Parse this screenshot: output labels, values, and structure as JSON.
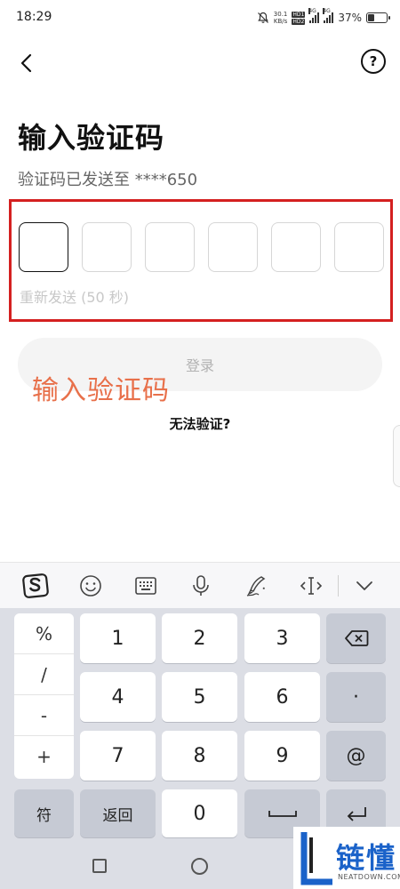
{
  "status_bar": {
    "time": "18:29",
    "net_speed_value": "30.1",
    "net_speed_unit": "KB/s",
    "hd_badge_1": "HD1",
    "hd_badge_2": "HD2",
    "network_1": "4G",
    "network_2": "4G",
    "battery_percent": "37%",
    "battery_level": 0.37
  },
  "header": {
    "back_icon": "chevron-left-icon",
    "help_icon": "question-circle-icon",
    "help_symbol": "?"
  },
  "page": {
    "title": "输入验证码",
    "subtitle": "验证码已发送至 ****650"
  },
  "code_input": {
    "box_count": 6,
    "active_index": 0,
    "resend_text": "重新发送 (50 秒)"
  },
  "login_button_label": "登录",
  "overlay_caption": "输入验证码",
  "cant_verify_link": "无法验证?",
  "keyboard_toolbar": {
    "icons": [
      "sogou-logo-icon",
      "emoji-icon",
      "keyboard-icon",
      "microphone-icon",
      "handwriting-icon",
      "cursor-move-icon",
      "chevron-down-icon"
    ]
  },
  "keyboard": {
    "symbols": [
      "%",
      "/",
      "-",
      "+"
    ],
    "digits": [
      "1",
      "2",
      "3",
      "4",
      "5",
      "6",
      "7",
      "8",
      "9",
      "0"
    ],
    "dot": "·",
    "at": "@",
    "symbol_switch": "符",
    "back_label": "返回",
    "colors": {
      "background": "#dcdee5",
      "key": "#ffffff",
      "function_key": "#c6cad4"
    }
  },
  "watermark": {
    "text": "链懂",
    "subtext": "NEATDOWN.COM",
    "color": "#1a62c9"
  },
  "accents": {
    "highlight_border": "#d42020",
    "caption_color": "#e8704a"
  }
}
